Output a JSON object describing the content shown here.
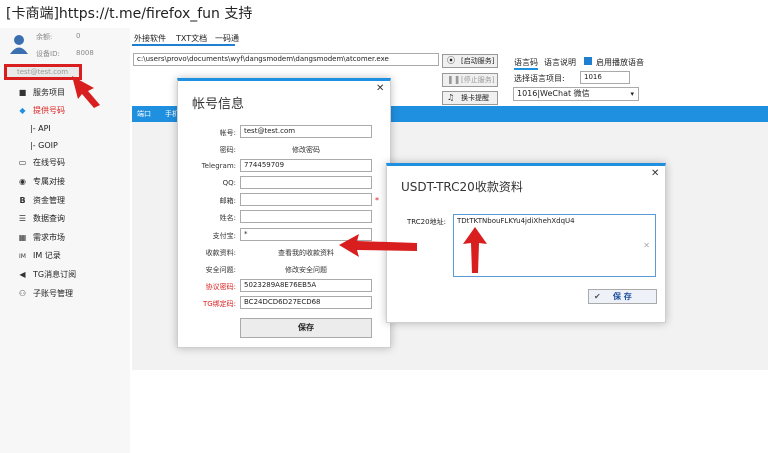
{
  "window": {
    "title": "[卡商端]https://t.me/firefox_fun 支持"
  },
  "user": {
    "balance_label": "余额:",
    "balance_value": "0",
    "device_label": "设备ID:",
    "device_value": "8008",
    "account": "test@test.com"
  },
  "sidebar": {
    "items": [
      {
        "icon": "■",
        "label": "服务项目"
      },
      {
        "icon": "◆",
        "label": "提供号码"
      },
      {
        "icon": "",
        "label": "|- API"
      },
      {
        "icon": "",
        "label": "|- GOIP"
      },
      {
        "icon": "▭",
        "label": "在线号码"
      },
      {
        "icon": "◉",
        "label": "专属对接"
      },
      {
        "icon": "B",
        "label": "资金管理"
      },
      {
        "icon": "☰",
        "label": "数据查询"
      },
      {
        "icon": "▦",
        "label": "需求市场"
      },
      {
        "icon": "IM",
        "label": "IM 记录"
      },
      {
        "icon": "◀",
        "label": "TG消息订阅"
      },
      {
        "icon": "⚇",
        "label": "子账号管理"
      }
    ]
  },
  "tabs": [
    "外接软件",
    "TXT文档",
    "一码通"
  ],
  "path": "c:\\users\\provo\\documents\\wyf\\dangsmodem\\dangsmodem\\atcomer.exe",
  "buttons": {
    "start": "[启动服务]",
    "stop": "[停止服务]",
    "remind": "换卡提醒"
  },
  "lang": {
    "tab1": "语言码",
    "tab2": "语言说明",
    "checkbox": "启用播放语音",
    "select_label": "选择语言项目:",
    "select_value": "1016",
    "dropdown_value": "1016|WeChat 微信"
  },
  "bluebar": {
    "col1": "端口",
    "col2": "手机"
  },
  "account_dialog": {
    "title": "帐号信息",
    "labels": [
      "帐号:",
      "密码:",
      "Telegram:",
      "QQ:",
      "邮箱:",
      "姓名:",
      "支付宝:",
      "收款资料:",
      "安全问题:",
      "协议密码:",
      "TG绑定码:"
    ],
    "account": "test@test.com",
    "change_password": "修改密码",
    "telegram": "774459709",
    "qq": "",
    "email": "",
    "name": "",
    "alipay": "*",
    "payment_link": "查看我的收款资料",
    "security_link": "修改安全问题",
    "protocol_pw": "5023289A8E76EB5A",
    "tg_code": "BC24DCD6D27ECD68",
    "save": "保存",
    "required_mark": "*"
  },
  "usdt_dialog": {
    "title": "USDT-TRC20收款资料",
    "label": "TRC20地址:",
    "address": "TDtTKTNbouFLKYu4jdiXhehXdqU4",
    "save": "保 存"
  },
  "colors": {
    "accent": "#1f8fe0",
    "highlight_red": "#d81e1e"
  }
}
